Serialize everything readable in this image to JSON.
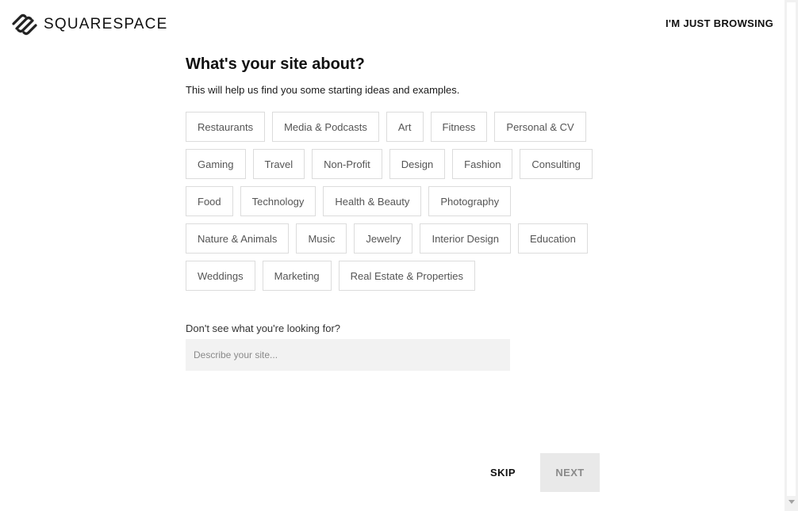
{
  "header": {
    "logo_text": "SQUARESPACE",
    "logo_icon": "squarespace-logo-icon",
    "browse_label": "I'M JUST BROWSING"
  },
  "main": {
    "title": "What's your site about?",
    "subtitle": "This will help us find you some starting ideas and examples.",
    "chips": [
      "Restaurants",
      "Media & Podcasts",
      "Art",
      "Fitness",
      "Personal & CV",
      "Gaming",
      "Travel",
      "Non-Profit",
      "Design",
      "Fashion",
      "Consulting",
      "Food",
      "Technology",
      "Health & Beauty",
      "Photography",
      "Nature & Animals",
      "Music",
      "Jewelry",
      "Interior Design",
      "Education",
      "Weddings",
      "Marketing",
      "Real Estate & Properties"
    ],
    "alt_label": "Don't see what you're looking for?",
    "describe_placeholder": "Describe your site...",
    "describe_value": ""
  },
  "footer": {
    "skip_label": "SKIP",
    "next_label": "NEXT"
  },
  "colors": {
    "text": "#111111",
    "chip_border": "#dcdcdc",
    "chip_text": "#555555",
    "input_bg": "#f2f2f2",
    "next_bg": "#e9e9e9",
    "next_text": "#8a8a8a"
  }
}
